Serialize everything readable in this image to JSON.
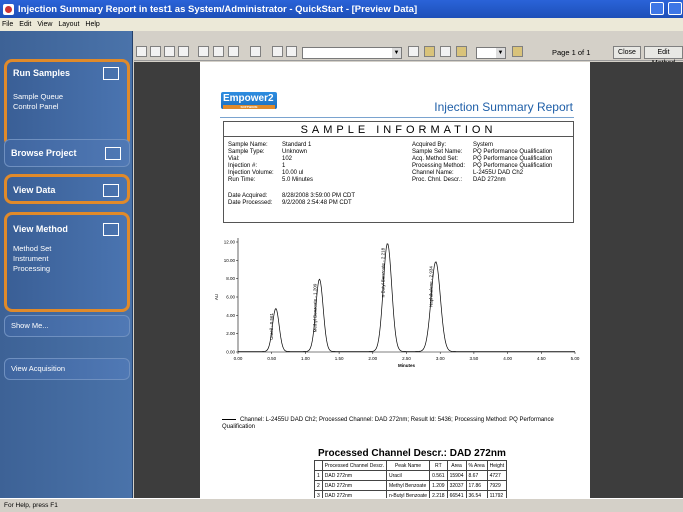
{
  "window": {
    "title": "Injection Summary Report in test1 as System/Administrator - QuickStart - [Preview Data]"
  },
  "menu": [
    "File",
    "Edit",
    "View",
    "Layout",
    "Help"
  ],
  "sidebar": {
    "run_samples": {
      "label": "Run Samples",
      "sub": [
        "Sample Queue",
        "Control Panel"
      ]
    },
    "browse_project": "Browse Project",
    "view_data": "View Data",
    "view_method": {
      "label": "View Method",
      "sub": [
        "Method Set",
        "Instrument",
        "Processing"
      ]
    },
    "show_me": "Show Me...",
    "view_acquisition": "View Acquisition"
  },
  "toolbar": {
    "page_label": "Page 1 of 1",
    "close_label": "Close",
    "edit_method_label": "Edit Method"
  },
  "report": {
    "logo": "Empower2",
    "logo_tag": "SOFTWARE",
    "title": "Injection Summary Report",
    "section_title": "SAMPLE INFORMATION",
    "left_fields": [
      [
        "Sample Name:",
        "Standard 1"
      ],
      [
        "Sample Type:",
        "Unknown"
      ],
      [
        "Vial:",
        "102"
      ],
      [
        "Injection #:",
        "1"
      ],
      [
        "Injection Volume:",
        "10.00 ul"
      ],
      [
        "Run Time:",
        "5.0 Minutes"
      ]
    ],
    "dates": [
      [
        "Date Acquired:",
        "8/28/2008 3:59:00 PM CDT"
      ],
      [
        "Date Processed:",
        "9/2/2008 2:54:48 PM CDT"
      ]
    ],
    "right_fields": [
      [
        "Acquired By:",
        "System"
      ],
      [
        "Sample Set Name:",
        "PQ Performance Qualification"
      ],
      [
        "Acq. Method Set:",
        "PQ Performance Qualification"
      ],
      [
        "Processing Method:",
        "PQ Performance Qualification"
      ],
      [
        "Channel Name:",
        "L-2455U DAD Ch2"
      ],
      [
        "Proc. Chnl. Descr.:",
        "DAD 272nm"
      ]
    ],
    "legend": "Channel: L-2455U DAD Ch2; Processed Channel: DAD 272nm; Result Id: 5436; Processing Method: PQ Performance Qualification",
    "table_title": "Processed Channel Descr.: DAD 272nm",
    "table_headers": [
      "",
      "Processed Channel Descr.",
      "Peak Name",
      "RT",
      "Area",
      "% Area",
      "Height"
    ],
    "table_rows": [
      [
        "1",
        "DAD 272nm",
        "Uracil",
        "0.561",
        "15904",
        "8.67",
        "4727"
      ],
      [
        "2",
        "DAD 272nm",
        "Methyl Benzoate",
        "1.209",
        "32037",
        "17.86",
        "7929"
      ],
      [
        "3",
        "DAD 272nm",
        "n-Butyl Benzoate",
        "2.218",
        "66541",
        "36.54",
        "11792"
      ],
      [
        "4",
        "DAD 272nm",
        "Naphthalene",
        "2.934",
        "66683",
        "36.72",
        "9811"
      ]
    ]
  },
  "chart_data": {
    "type": "line",
    "xlabel": "Minutes",
    "ylabel": "AU",
    "xlim": [
      0,
      5.0
    ],
    "ylim": [
      0,
      0.012
    ],
    "x_ticks": [
      "0.00",
      "0.50",
      "1.00",
      "1.50",
      "2.00",
      "2.50",
      "3.00",
      "3.50",
      "4.00",
      "4.50",
      "5.00"
    ],
    "y_ticks": [
      "0.00",
      "2.00",
      "4.00",
      "6.00",
      "8.00",
      "10.00",
      "12.00"
    ],
    "peaks": [
      {
        "name": "Uracil",
        "rt": 0.561,
        "height": 0.0047
      },
      {
        "name": "Methyl Benzoate",
        "rt": 1.209,
        "height": 0.0079
      },
      {
        "name": "n-Butyl Benzoate",
        "rt": 2.218,
        "height": 0.0118
      },
      {
        "name": "Naphthalene",
        "rt": 2.934,
        "height": 0.0098
      }
    ],
    "peak_labels": [
      "Uracil - 0.561",
      "Methyl Benzoate - 1.209",
      "n-Butyl Benzoate - 2.218",
      "Naphthalene - 2.934"
    ]
  },
  "status": "For Help, press F1"
}
